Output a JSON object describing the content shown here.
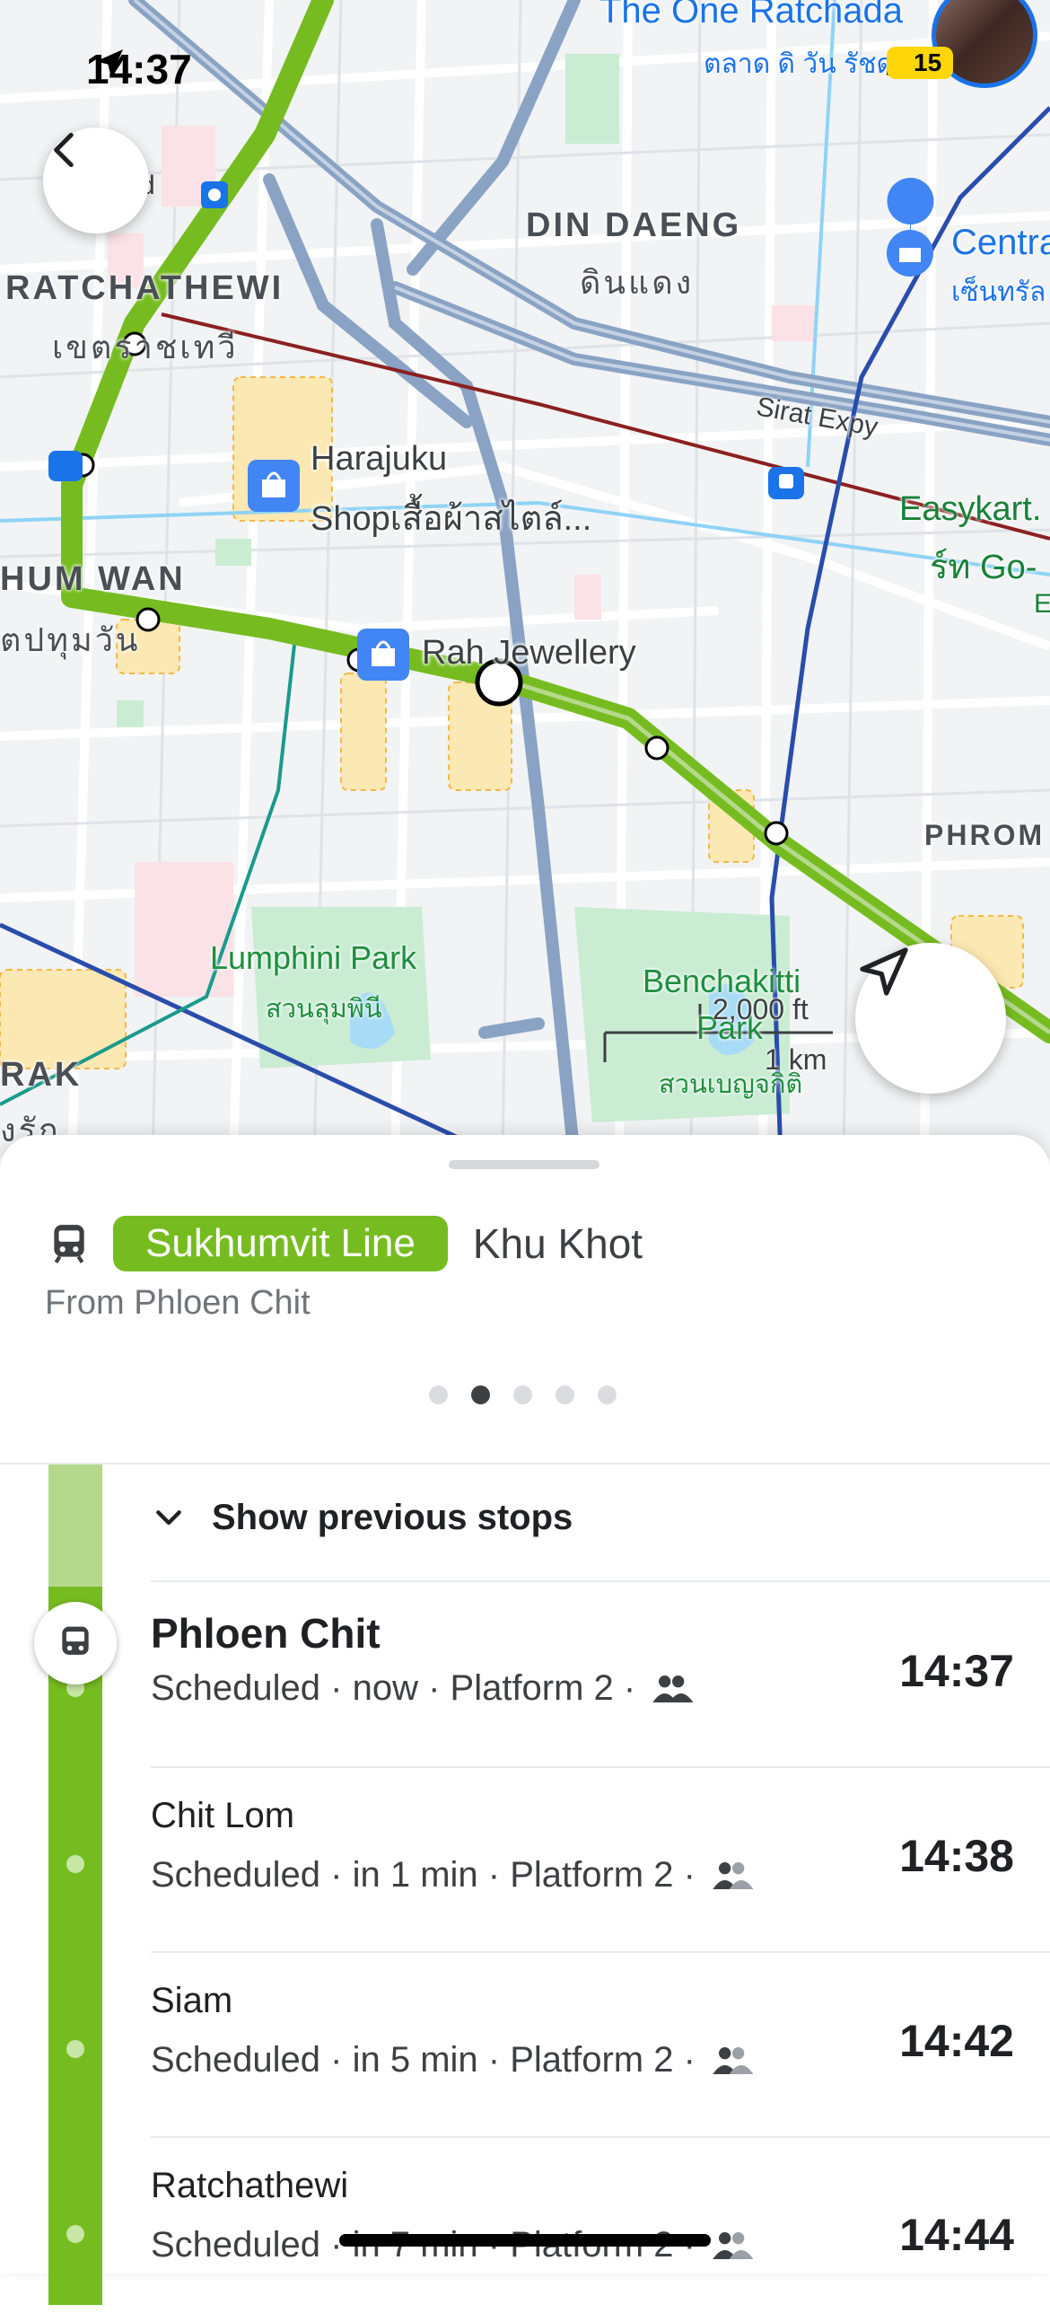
{
  "status_bar": {
    "time": "14:37",
    "battery": "15"
  },
  "map": {
    "areas": {
      "din_daeng": "DIN DAENG",
      "din_daeng_th": "ดินแดง",
      "ratchathewi": "RATCHATHEWI",
      "ratchathewi_th": "เขตราชเทวี",
      "pathum_wan": "HUM WAN",
      "pathum_wan_th": "ตปทุมวัน",
      "bang_rak": "RAK",
      "bang_rak_th": "งรัก",
      "phrom": "PHROM"
    },
    "pois": {
      "one_ratchada": "The One Ratchada",
      "one_ratchada_th": "ตลาด ดิ วัน รัชดา",
      "harajuku_1": "Harajuku",
      "harajuku_2": "Shopเสื้อผ้าสไตล์...",
      "rah_jewellery": "Rah Jewellery",
      "central": "Centra",
      "central_th": "เซ็นทรัล",
      "easykart": "Easykart.",
      "easykart_th": "ร์ท Go-",
      "easykart_e": "E"
    },
    "parks": {
      "lumphini": "Lumphini Park",
      "lumphini_th": "สวนลุมพินี",
      "benchakitti": "Benchakitti",
      "benchakitti_2": "Park",
      "benchakitti_th": "สวนเบญจกิติ"
    },
    "roads": {
      "sirat": "Sirat Expy"
    },
    "scale": {
      "imperial": "2,000 ft",
      "metric": "1 km"
    },
    "partial_label_top_left": "d"
  },
  "sheet": {
    "line_name": "Sukhumvit Line",
    "line_color": "#76bc21",
    "destination": "Khu Khot",
    "from_text": "From Phloen Chit",
    "page_dots": 5,
    "active_dot": 1,
    "show_previous": "Show previous stops",
    "stops": [
      {
        "name": "Phloen Chit",
        "detail": "Scheduled · now · Platform 2 ·",
        "time": "14:37",
        "current": true
      },
      {
        "name": "Chit Lom",
        "detail": "Scheduled · in 1 min · Platform 2 ·",
        "time": "14:38",
        "current": false
      },
      {
        "name": "Siam",
        "detail": "Scheduled · in 5 min · Platform 2 ·",
        "time": "14:42",
        "current": false
      },
      {
        "name": "Ratchathewi",
        "detail": "Scheduled · in 7 min · Platform 2 ·",
        "time": "14:44",
        "current": false
      }
    ]
  }
}
